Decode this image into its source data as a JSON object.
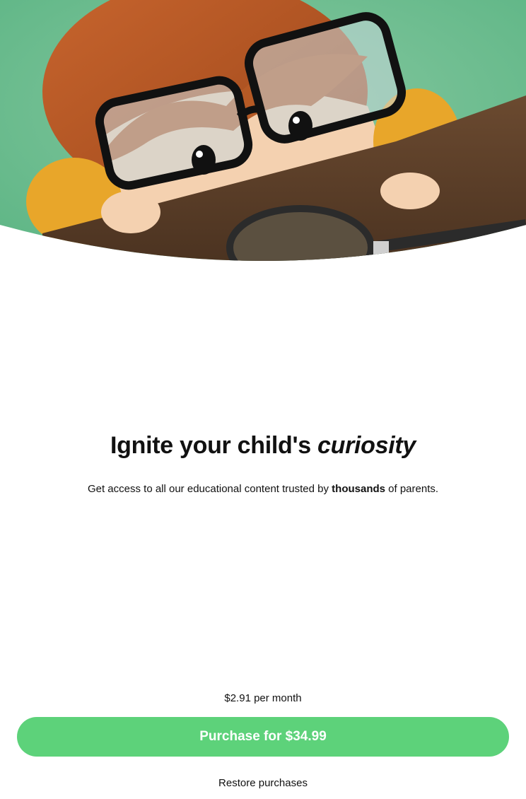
{
  "hero": {
    "image_name": "child-with-magnifying-glass-illustration"
  },
  "headline": {
    "prefix": "Ignite your child's ",
    "accent": "curiosity"
  },
  "subtitle": {
    "before": "Get access to all our educational content trusted by ",
    "bold": "thousands",
    "after": " of parents."
  },
  "pricing": {
    "monthly_note": "$2.91 per month"
  },
  "purchase_button": {
    "label": "Purchase for $34.99",
    "color": "#5dd27a"
  },
  "restore": {
    "label": "Restore purchases"
  }
}
